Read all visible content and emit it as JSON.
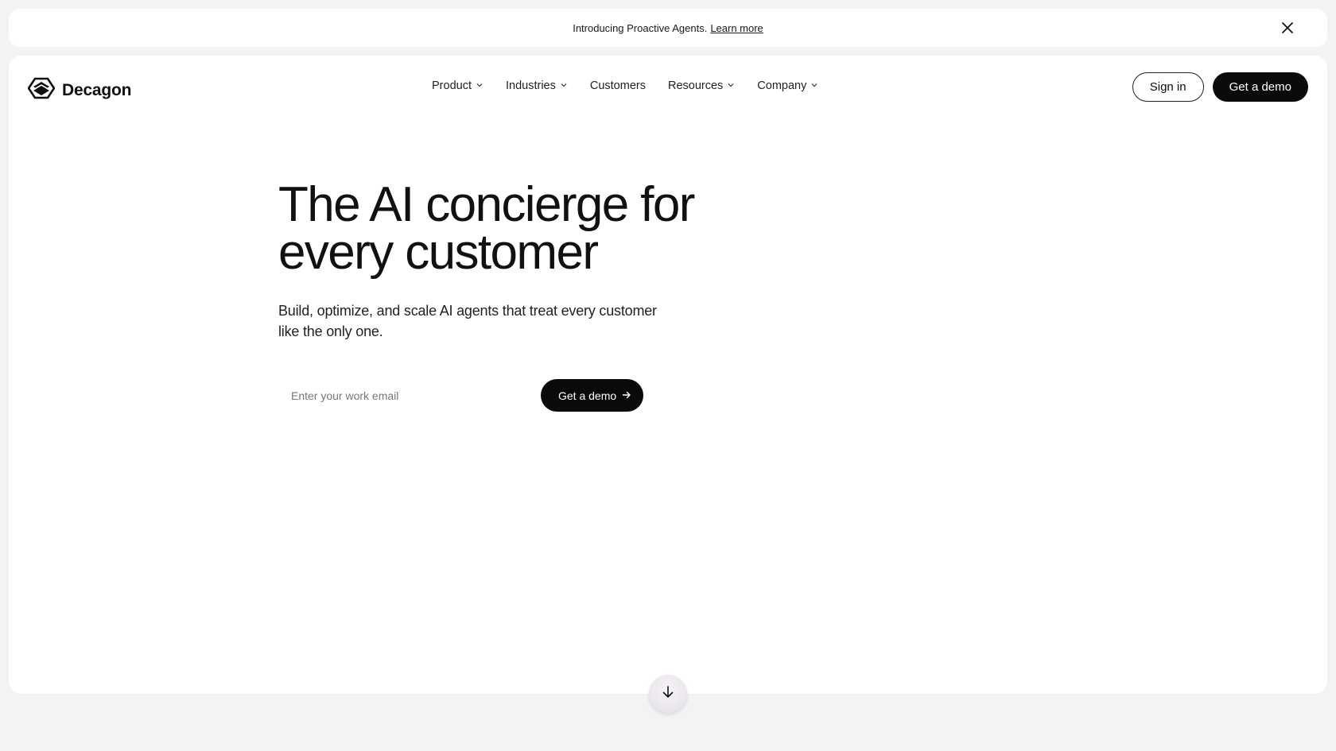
{
  "announcement": {
    "text": "Introducing Proactive Agents.",
    "link": "Learn more"
  },
  "header": {
    "brand": "Decagon",
    "nav": [
      {
        "label": "Product",
        "has_dropdown": true
      },
      {
        "label": "Industries",
        "has_dropdown": true
      },
      {
        "label": "Customers",
        "has_dropdown": false
      },
      {
        "label": "Resources",
        "has_dropdown": true
      },
      {
        "label": "Company",
        "has_dropdown": true
      }
    ],
    "sign_in": "Sign in",
    "get_demo": "Get a demo"
  },
  "hero": {
    "title_line1": "The AI concierge for",
    "title_line2": "every customer",
    "subtitle_line1": "Build, optimize, and scale AI agents that treat every customer",
    "subtitle_line2": "like the only one.",
    "email_placeholder": "Enter your work email",
    "cta": "Get a demo"
  },
  "icons": {
    "close": "close-icon",
    "logo": "decagon-logo-icon",
    "chevron": "chevron-down-icon",
    "arrow_right": "arrow-right-icon",
    "scroll": "arrow-down-icon"
  },
  "colors": {
    "page_bg": "#f3f3f3",
    "surface": "#ffffff",
    "primary_button": "#0a0a0a",
    "text": "#111111"
  }
}
